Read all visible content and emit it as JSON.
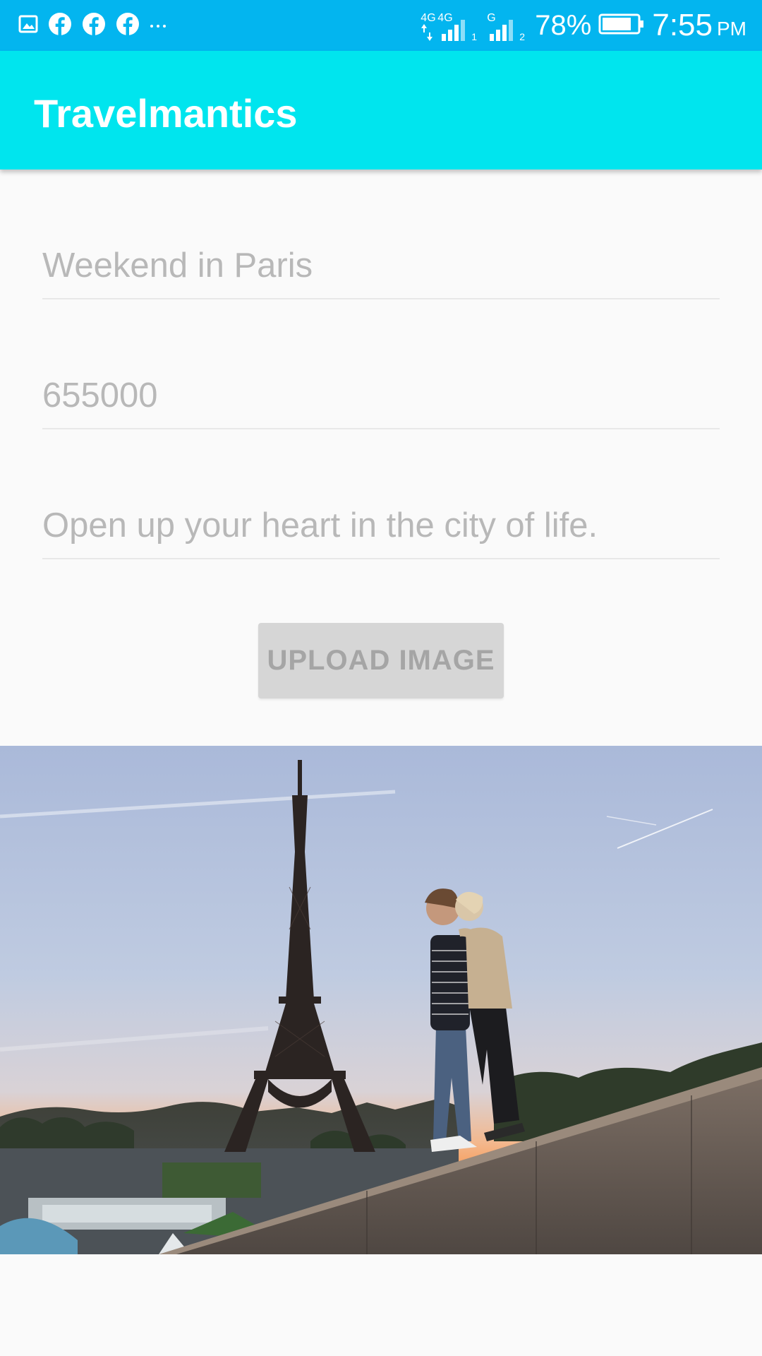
{
  "status_bar": {
    "network_primary": "4G",
    "network_secondary": "4G",
    "sim1_label": "1",
    "sim2_type": "G",
    "sim2_label": "2",
    "battery_percent": "78%",
    "time": "7:55",
    "ampm": "PM",
    "notification_icons": [
      "image-icon",
      "facebook-icon",
      "facebook-icon",
      "facebook-icon",
      "more-notifications-icon"
    ],
    "colors": {
      "background": "#03b5ef"
    }
  },
  "app_bar": {
    "title": "Travelmantics",
    "colors": {
      "background": "#00e5ee"
    }
  },
  "form": {
    "title_field": {
      "value": "Weekend in Paris"
    },
    "price_field": {
      "value": "655000"
    },
    "description_field": {
      "value": "Open up your heart in the city of life."
    },
    "upload_button": {
      "label": "UPLOAD IMAGE"
    }
  },
  "image": {
    "icon": "eiffel-tower-couple-photo"
  }
}
